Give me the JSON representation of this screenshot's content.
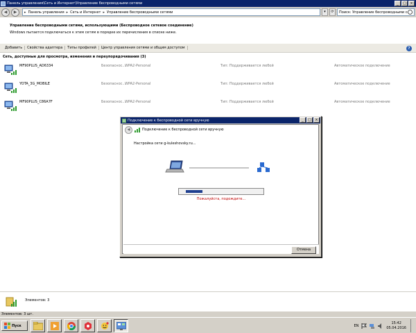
{
  "window": {
    "title": "Панель управления\\Сеть и Интернет\\Управление беспроводными сетями"
  },
  "address": {
    "crumbs": [
      "Панель управления",
      "Сеть и Интернет",
      "Управление беспроводными сетями"
    ],
    "search_placeholder": "Поиск: Управление беспроводными сетями"
  },
  "header": {
    "title": "Управление беспроводными сетями, использующими (Беспроводное сетевое соединение)",
    "subtitle": "Windows пытается подключаться к этим сетям в порядке их перечисления в списке ниже."
  },
  "toolbar": {
    "items": [
      "Добавить",
      "Свойства адаптера",
      "Типы профилей",
      "Центр управления сетями и общим доступом"
    ],
    "help_label": "?"
  },
  "networks": {
    "group_label": "Сеть, доступные для просмотра, изменения и переупорядочивания (3)",
    "items": [
      {
        "name": "MF90PLUS_AD6334",
        "security": "Безопаснос...",
        "auth": "WPA2-Personal",
        "type": "Тип: Поддерживается любой",
        "mode": "Автоматическое подключение"
      },
      {
        "name": "YOTA_3G_MOBILE",
        "security": "Безопаснос...",
        "auth": "WPA2-Personal",
        "type": "Тип: Поддерживается любой",
        "mode": "Автоматическое подключение"
      },
      {
        "name": "MF90PLUS_C86A7F",
        "security": "Безопаснос...",
        "auth": "WPA2-Personal",
        "type": "Тип: Поддерживается любой",
        "mode": "Автоматическое подключение"
      }
    ]
  },
  "details": {
    "text": "Элементов: 3"
  },
  "statusbar": {
    "text": "Элементов: 3 шт."
  },
  "dialog": {
    "title": "Подключение к беспроводной сети вручную",
    "header": "Подключение к беспроводной сети вручную",
    "setup_text": "Настройка сети g-kuleshovsky.ru...",
    "progress": 0.2,
    "wait_text": "Пожалуйста, подождите...",
    "cancel_label": "Отмена"
  },
  "taskbar": {
    "start_label": "Пуск",
    "lang": "EN",
    "time": "15:42",
    "date": "05.04.2016"
  },
  "colors": {
    "titlebar": "#0a246a",
    "wait_text": "#c00000",
    "progress": "#1f3f8f"
  }
}
